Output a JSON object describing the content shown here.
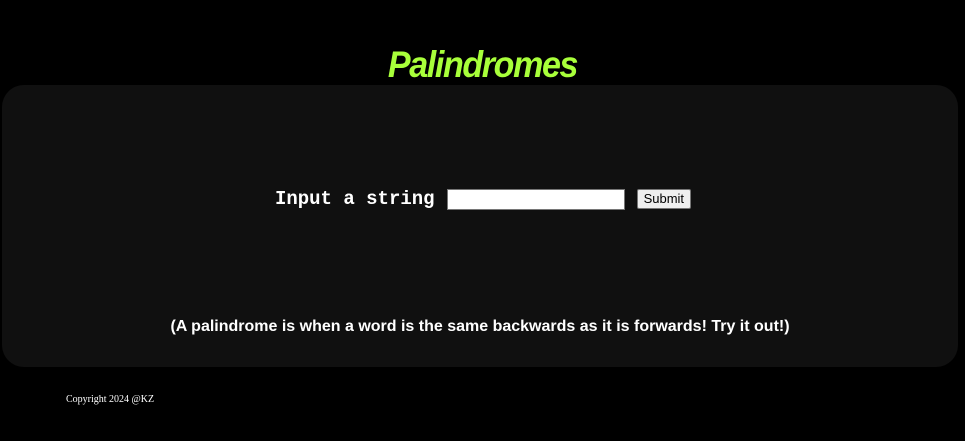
{
  "header": {
    "title": "Palindromes",
    "title_color": "#a8ff3a"
  },
  "panel": {
    "background": "#101010",
    "form": {
      "label": "Input a string",
      "input_value": "",
      "submit_label": "Submit"
    },
    "explanation": "(A palindrome is when a word is the same backwards as it is forwards! Try it out!)"
  },
  "footer": {
    "copyright": "Copyright 2024 @KZ"
  }
}
